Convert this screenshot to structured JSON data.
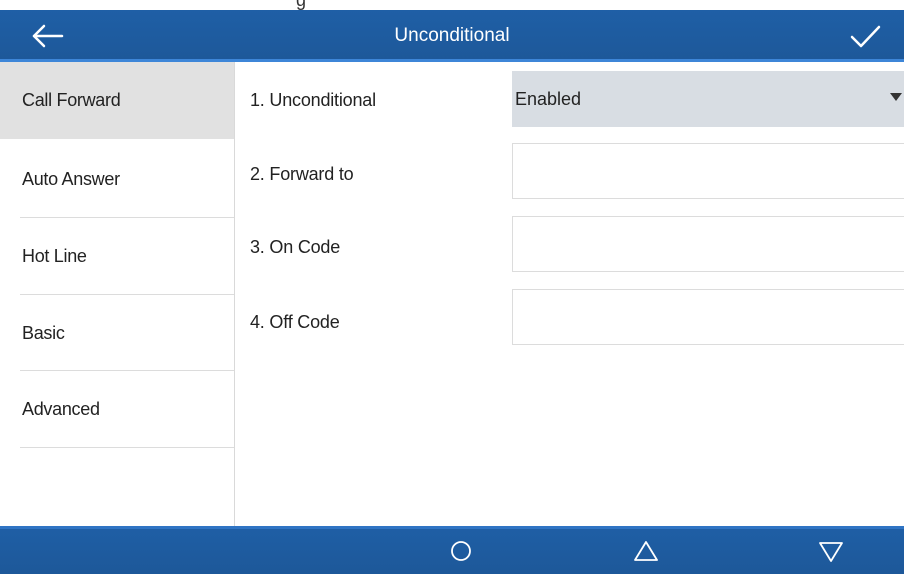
{
  "top_strip_text": "g",
  "header": {
    "title": "Unconditional"
  },
  "sidebar": {
    "items": [
      {
        "label": "Call Forward",
        "selected": true
      },
      {
        "label": "Auto Answer",
        "selected": false
      },
      {
        "label": "Hot Line",
        "selected": false
      },
      {
        "label": "Basic",
        "selected": false
      },
      {
        "label": "Advanced",
        "selected": false
      }
    ]
  },
  "form": {
    "fields": [
      {
        "label": "1. Unconditional",
        "type": "select",
        "value": "Enabled"
      },
      {
        "label": "2. Forward to",
        "type": "input",
        "value": ""
      },
      {
        "label": "3. On Code",
        "type": "input",
        "value": ""
      },
      {
        "label": "4. Off Code",
        "type": "input",
        "value": ""
      }
    ]
  },
  "icons": {
    "back": "arrow-left-icon",
    "confirm": "checkmark-icon",
    "home": "circle-icon",
    "up": "triangle-up-icon",
    "down": "triangle-down-icon",
    "dropdown": "caret-down-icon"
  },
  "colors": {
    "bar": "#1f5fa6",
    "accent": "#3d86d8",
    "selected_bg": "#e1e1e1",
    "select_bg": "#d8dde3"
  }
}
